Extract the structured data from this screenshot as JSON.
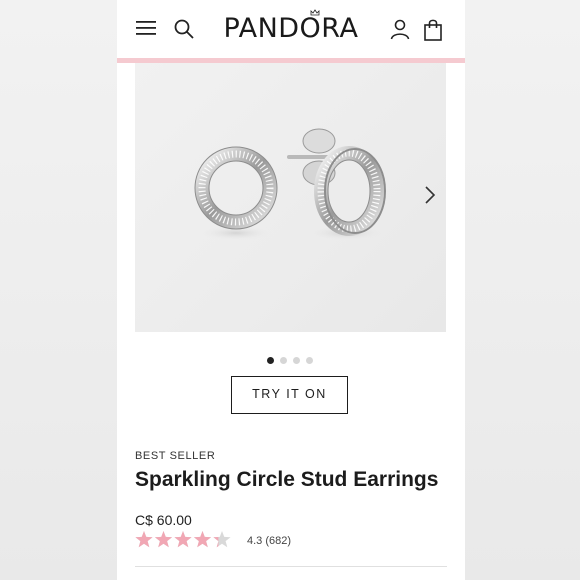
{
  "header": {
    "logo_text": "PANDORA",
    "icons": {
      "menu": "hamburger-menu-icon",
      "search": "search-icon",
      "account": "account-icon",
      "bag": "shopping-bag-icon"
    },
    "accent_color": "#f5cad0"
  },
  "gallery": {
    "image_alt": "Sparkling Circle Stud Earrings",
    "slide_count": 4,
    "active_slide": 1,
    "next_icon": "chevron-right-icon"
  },
  "actions": {
    "try_on_label": "TRY IT ON"
  },
  "product": {
    "badge": "BEST SELLER",
    "title": "Sparkling Circle Stud Earrings",
    "price": "C$ 60.00",
    "rating": {
      "value": 4.3,
      "max": 5,
      "text": "4.3",
      "count_text": "(682)"
    },
    "star_color": "#f1a7b4"
  }
}
